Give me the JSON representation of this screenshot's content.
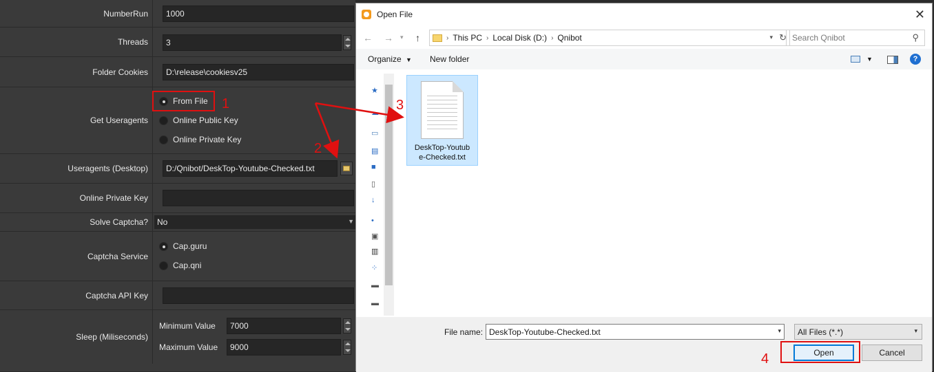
{
  "settings": {
    "number_run": {
      "label": "NumberRun",
      "value": "1000"
    },
    "threads": {
      "label": "Threads",
      "value": "3"
    },
    "folder_cookies": {
      "label": "Folder Cookies",
      "value": "D:\\release\\cookiesv25"
    },
    "get_useragents": {
      "label": "Get Useragents",
      "options": [
        "From File",
        "Online Public Key",
        "Online Private Key"
      ],
      "selected": "From File"
    },
    "useragents_desktop": {
      "label": "Useragents (Desktop)",
      "value": "D:/Qnibot/DeskTop-Youtube-Checked.txt"
    },
    "online_private_key": {
      "label": "Online Private Key",
      "value": ""
    },
    "solve_captcha": {
      "label": "Solve Captcha?",
      "value": "No"
    },
    "captcha_service": {
      "label": "Captcha Service",
      "options": [
        "Cap.guru",
        "Cap.qni"
      ],
      "selected": "Cap.guru"
    },
    "captcha_api_key": {
      "label": "Captcha API Key",
      "value": ""
    },
    "sleep": {
      "label": "Sleep (Miliseconds)",
      "min_label": "Minimum Value",
      "min_value": "7000",
      "max_label": "Maximum Value",
      "max_value": "9000"
    }
  },
  "annotations": {
    "a1": "1",
    "a2": "2",
    "a3": "3",
    "a4": "4",
    "color": "#e01010"
  },
  "dialog": {
    "title": "Open File",
    "breadcrumb": [
      "This PC",
      "Local Disk (D:)",
      "Qnibot"
    ],
    "search_placeholder": "Search Qnibot",
    "toolbar": {
      "organize": "Organize",
      "new_folder": "New folder"
    },
    "file": {
      "name_line1": "DeskTop-Youtub",
      "name_line2": "e-Checked.txt"
    },
    "file_name_label": "File name:",
    "file_name_value": "DeskTop-Youtube-Checked.txt",
    "file_type": "All Files (*.*)",
    "open_label": "Open",
    "cancel_label": "Cancel"
  }
}
